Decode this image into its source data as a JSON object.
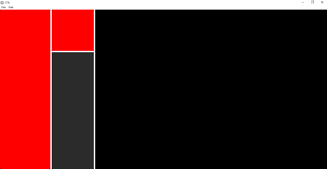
{
  "window": {
    "title": "CTk",
    "controls": {
      "minimize_glyph": "–",
      "maximize_glyph": "❐",
      "close_glyph": "✕"
    }
  },
  "menubar": {
    "items": [
      {
        "label": "File"
      },
      {
        "label": "Edit"
      }
    ]
  },
  "colors": {
    "background": "#000000",
    "panel_red": "#ff0000",
    "panel_dark": "#2b2b2b",
    "divider": "#ffffff"
  }
}
